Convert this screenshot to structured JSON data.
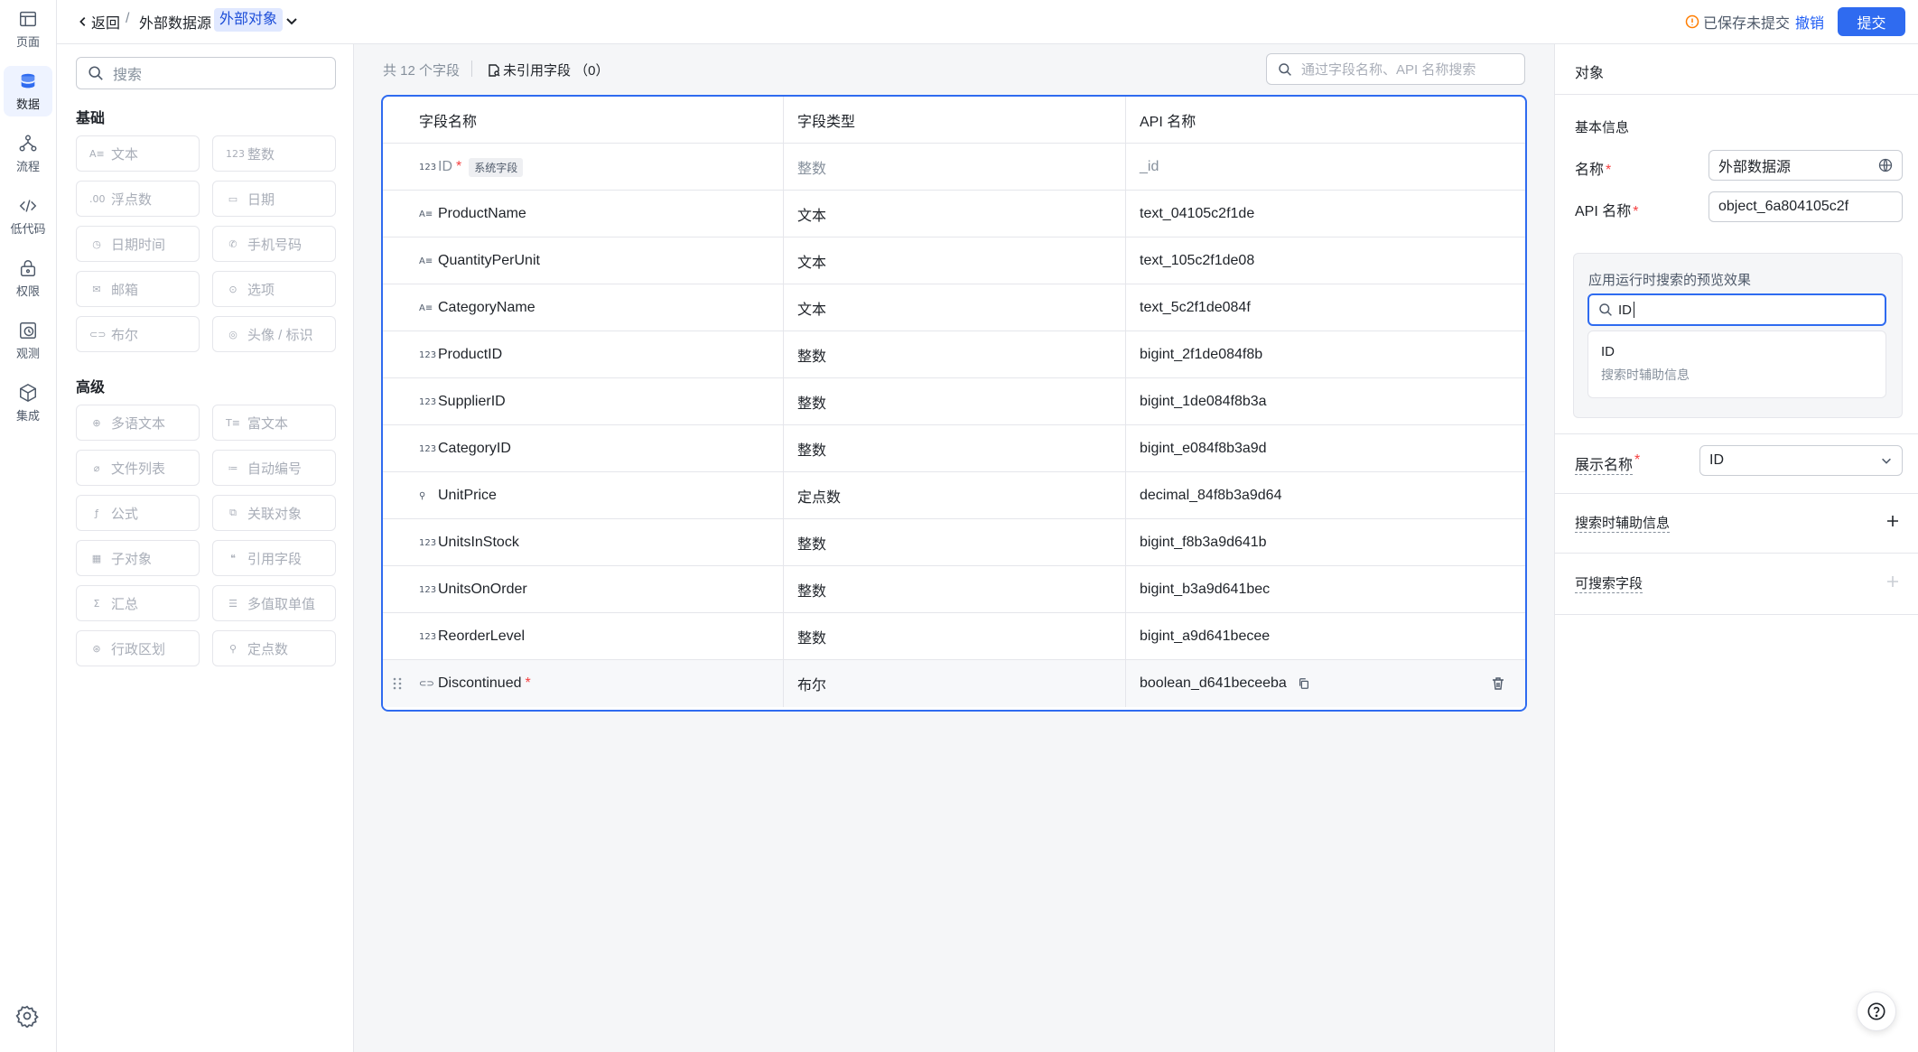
{
  "nav": {
    "items": [
      {
        "label": "页面",
        "icon": "layout-icon"
      },
      {
        "label": "数据",
        "icon": "database-icon",
        "active": true
      },
      {
        "label": "流程",
        "icon": "flow-icon"
      },
      {
        "label": "低代码",
        "icon": "code-icon"
      },
      {
        "label": "权限",
        "icon": "lock-icon"
      },
      {
        "label": "观测",
        "icon": "monitor-icon"
      },
      {
        "label": "集成",
        "icon": "cube-icon"
      }
    ]
  },
  "topbar": {
    "back_label": "返回",
    "separator": "/",
    "title": "外部数据源",
    "tag": "外部对象",
    "save_status": "已保存未提交",
    "undo_label": "撤销",
    "submit_label": "提交"
  },
  "palette": {
    "search_placeholder": "搜索",
    "basic_title": "基础",
    "basic": [
      {
        "icon": "A≡",
        "label": "文本"
      },
      {
        "icon": "123",
        "label": "整数"
      },
      {
        "icon": ".00",
        "label": "浮点数"
      },
      {
        "icon": "▭",
        "label": "日期"
      },
      {
        "icon": "◷",
        "label": "日期时间"
      },
      {
        "icon": "✆",
        "label": "手机号码"
      },
      {
        "icon": "✉",
        "label": "邮箱"
      },
      {
        "icon": "⊙",
        "label": "选项"
      },
      {
        "icon": "⊂⊃",
        "label": "布尔"
      },
      {
        "icon": "◎",
        "label": "头像 / 标识"
      }
    ],
    "advanced_title": "高级",
    "advanced": [
      {
        "icon": "⊕",
        "label": "多语文本"
      },
      {
        "icon": "T≡",
        "label": "富文本"
      },
      {
        "icon": "⌀",
        "label": "文件列表"
      },
      {
        "icon": "≔",
        "label": "自动编号"
      },
      {
        "icon": "ƒ",
        "label": "公式"
      },
      {
        "icon": "⧉",
        "label": "关联对象"
      },
      {
        "icon": "▦",
        "label": "子对象"
      },
      {
        "icon": "❝",
        "label": "引用字段"
      },
      {
        "icon": "Σ",
        "label": "汇总"
      },
      {
        "icon": "☰",
        "label": "多值取单值"
      },
      {
        "icon": "⊛",
        "label": "行政区划"
      },
      {
        "icon": "⚲",
        "label": "定点数"
      }
    ]
  },
  "main": {
    "count_text": "共 12 个字段",
    "unref_label": "未引用字段 （0）",
    "search_placeholder": "通过字段名称、API 名称搜索",
    "columns": [
      "字段名称",
      "字段类型",
      "API 名称"
    ],
    "rows": [
      {
        "icon": "123",
        "name": "ID",
        "required": true,
        "tag": "系统字段",
        "type": "整数",
        "api": "_id",
        "dim": true
      },
      {
        "icon": "A≡",
        "name": "ProductName",
        "type": "文本",
        "api": "text_04105c2f1de"
      },
      {
        "icon": "A≡",
        "name": "QuantityPerUnit",
        "type": "文本",
        "api": "text_105c2f1de08"
      },
      {
        "icon": "A≡",
        "name": "CategoryName",
        "type": "文本",
        "api": "text_5c2f1de084f"
      },
      {
        "icon": "123",
        "name": "ProductID",
        "type": "整数",
        "api": "bigint_2f1de084f8b"
      },
      {
        "icon": "123",
        "name": "SupplierID",
        "type": "整数",
        "api": "bigint_1de084f8b3a"
      },
      {
        "icon": "123",
        "name": "CategoryID",
        "type": "整数",
        "api": "bigint_e084f8b3a9d"
      },
      {
        "icon": "⚲",
        "name": "UnitPrice",
        "type": "定点数",
        "api": "decimal_84f8b3a9d64"
      },
      {
        "icon": "123",
        "name": "UnitsInStock",
        "type": "整数",
        "api": "bigint_f8b3a9d641b"
      },
      {
        "icon": "123",
        "name": "UnitsOnOrder",
        "type": "整数",
        "api": "bigint_b3a9d641bec"
      },
      {
        "icon": "123",
        "name": "ReorderLevel",
        "type": "整数",
        "api": "bigint_a9d641becee"
      },
      {
        "icon": "⊂⊃",
        "name": "Discontinued",
        "required": true,
        "type": "布尔",
        "api": "boolean_d641beceeba",
        "hover": true
      }
    ]
  },
  "panel": {
    "title": "对象",
    "basic_info": "基本信息",
    "name_label": "名称",
    "name_value": "外部数据源",
    "api_label": "API 名称",
    "api_value": "object_6a804105c2f",
    "preview_label": "应用运行时搜索的预览效果",
    "preview_input": "ID",
    "preview_result_name": "ID",
    "preview_result_aux": "搜索时辅助信息",
    "display_label": "展示名称",
    "display_value": "ID",
    "aux_label": "搜索时辅助信息",
    "searchable_label": "可搜索字段",
    "req_mark": "*"
  },
  "colors": {
    "accent": "#2f6bf0",
    "required": "#f53f3f",
    "tag_bg": "#e0e8ff"
  }
}
